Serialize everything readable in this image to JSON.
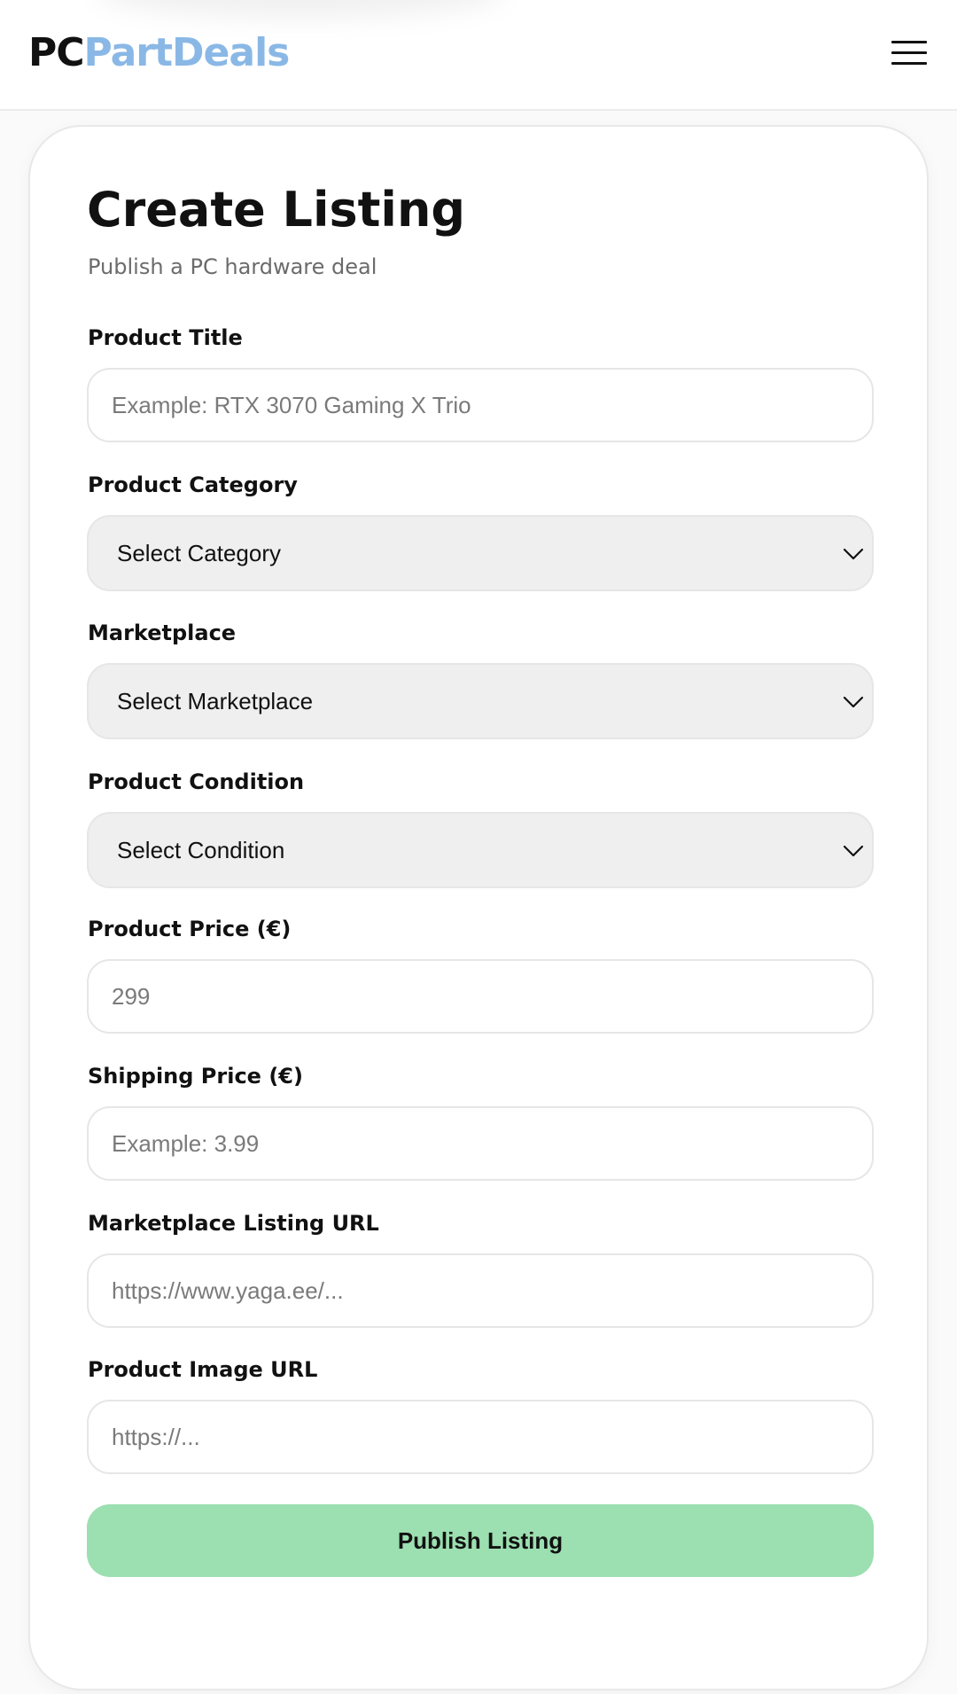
{
  "header": {
    "logo_part1": "PC",
    "logo_part2": "PartDeals",
    "menu_icon": "hamburger-menu-icon"
  },
  "colors": {
    "logo_accent": "#8ab8e6",
    "publish_button": "#9cdfb0",
    "select_background": "#efefef"
  },
  "form": {
    "title": "Create Listing",
    "subtitle": "Publish a PC hardware deal",
    "product_title": {
      "label": "Product Title",
      "value": "",
      "placeholder": "Example: RTX 3070 Gaming X Trio"
    },
    "product_category": {
      "label": "Product Category",
      "selected": "Select Category"
    },
    "marketplace": {
      "label": "Marketplace",
      "selected": "Select Marketplace"
    },
    "product_condition": {
      "label": "Product Condition",
      "selected": "Select Condition"
    },
    "product_price": {
      "label": "Product Price (€)",
      "value": "",
      "placeholder": "299"
    },
    "shipping_price": {
      "label": "Shipping Price (€)",
      "value": "",
      "placeholder": "Example: 3.99"
    },
    "listing_url": {
      "label": "Marketplace Listing URL",
      "value": "",
      "placeholder": "https://www.yaga.ee/..."
    },
    "image_url": {
      "label": "Product Image URL",
      "value": "",
      "placeholder": "https://..."
    },
    "submit_label": "Publish Listing"
  }
}
